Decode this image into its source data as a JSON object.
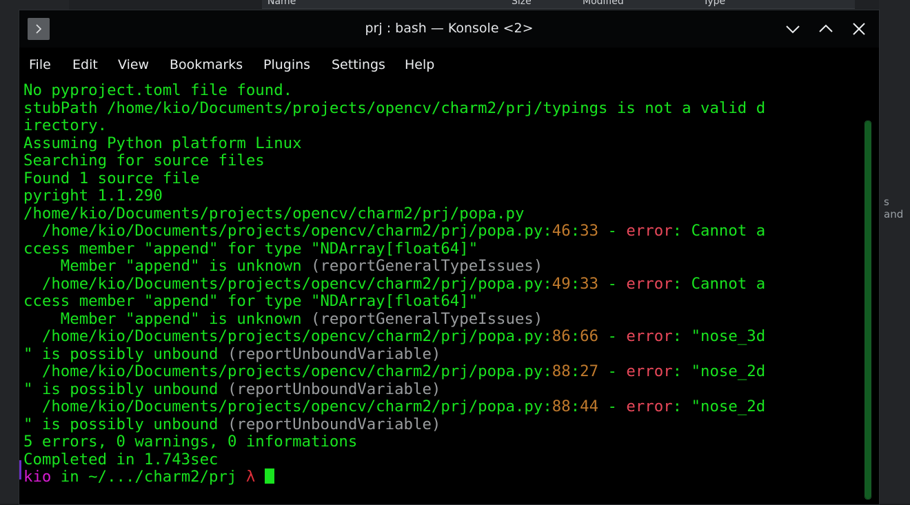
{
  "background": {
    "columns": [
      "Name",
      "Size",
      "Modified",
      "Type"
    ],
    "right_text": "s and"
  },
  "window": {
    "title": "prj : bash — Konsole <2>",
    "app_icon": "chevron-right-icon",
    "controls": [
      "minimize-icon",
      "maximize-icon",
      "close-icon"
    ]
  },
  "menu": {
    "items": [
      "File",
      "Edit",
      "View",
      "Bookmarks",
      "Plugins",
      "Settings",
      "Help"
    ]
  },
  "terminal": {
    "lines": [
      {
        "segments": [
          {
            "t": "No pyproject.toml file found.",
            "c": "g"
          }
        ]
      },
      {
        "segments": [
          {
            "t": "stubPath /home/kio/Documents/projects/opencv/charm2/prj/typings is not a valid d",
            "c": "g"
          }
        ]
      },
      {
        "segments": [
          {
            "t": "irectory.",
            "c": "g"
          }
        ]
      },
      {
        "segments": [
          {
            "t": "Assuming Python platform Linux",
            "c": "g"
          }
        ]
      },
      {
        "segments": [
          {
            "t": "Searching for source files",
            "c": "g"
          }
        ]
      },
      {
        "segments": [
          {
            "t": "Found 1 source file",
            "c": "g"
          }
        ]
      },
      {
        "segments": [
          {
            "t": "pyright 1.1.290",
            "c": "g"
          }
        ]
      },
      {
        "segments": [
          {
            "t": "/home/kio/Documents/projects/opencv/charm2/prj/popa.py",
            "c": "g"
          }
        ]
      },
      {
        "segments": [
          {
            "t": "  /home/kio/Documents/projects/opencv/charm2/prj/popa.py:",
            "c": "g"
          },
          {
            "t": "46",
            "c": "n"
          },
          {
            "t": ":",
            "c": "g"
          },
          {
            "t": "33",
            "c": "n"
          },
          {
            "t": " - ",
            "c": "g"
          },
          {
            "t": "error",
            "c": "e"
          },
          {
            "t": ": Cannot a",
            "c": "g"
          }
        ]
      },
      {
        "segments": [
          {
            "t": "ccess member \"append\" for type \"NDArray[float64]\"",
            "c": "g"
          }
        ]
      },
      {
        "segments": [
          {
            "t": "    Member \"append\" is unknown ",
            "c": "g"
          },
          {
            "t": "(reportGeneralTypeIssues)",
            "c": "d"
          }
        ]
      },
      {
        "segments": [
          {
            "t": "  /home/kio/Documents/projects/opencv/charm2/prj/popa.py:",
            "c": "g"
          },
          {
            "t": "49",
            "c": "n"
          },
          {
            "t": ":",
            "c": "g"
          },
          {
            "t": "33",
            "c": "n"
          },
          {
            "t": " - ",
            "c": "g"
          },
          {
            "t": "error",
            "c": "e"
          },
          {
            "t": ": Cannot a",
            "c": "g"
          }
        ]
      },
      {
        "segments": [
          {
            "t": "ccess member \"append\" for type \"NDArray[float64]\"",
            "c": "g"
          }
        ]
      },
      {
        "segments": [
          {
            "t": "    Member \"append\" is unknown ",
            "c": "g"
          },
          {
            "t": "(reportGeneralTypeIssues)",
            "c": "d"
          }
        ]
      },
      {
        "segments": [
          {
            "t": "  /home/kio/Documents/projects/opencv/charm2/prj/popa.py:",
            "c": "g"
          },
          {
            "t": "86",
            "c": "n"
          },
          {
            "t": ":",
            "c": "g"
          },
          {
            "t": "66",
            "c": "n"
          },
          {
            "t": " - ",
            "c": "g"
          },
          {
            "t": "error",
            "c": "e"
          },
          {
            "t": ": \"nose_3d",
            "c": "g"
          }
        ]
      },
      {
        "segments": [
          {
            "t": "\" is possibly unbound ",
            "c": "g"
          },
          {
            "t": "(reportUnboundVariable)",
            "c": "d"
          }
        ]
      },
      {
        "segments": [
          {
            "t": "  /home/kio/Documents/projects/opencv/charm2/prj/popa.py:",
            "c": "g"
          },
          {
            "t": "88",
            "c": "n"
          },
          {
            "t": ":",
            "c": "g"
          },
          {
            "t": "27",
            "c": "n"
          },
          {
            "t": " - ",
            "c": "g"
          },
          {
            "t": "error",
            "c": "e"
          },
          {
            "t": ": \"nose_2d",
            "c": "g"
          }
        ]
      },
      {
        "segments": [
          {
            "t": "\" is possibly unbound ",
            "c": "g"
          },
          {
            "t": "(reportUnboundVariable)",
            "c": "d"
          }
        ]
      },
      {
        "segments": [
          {
            "t": "  /home/kio/Documents/projects/opencv/charm2/prj/popa.py:",
            "c": "g"
          },
          {
            "t": "88",
            "c": "n"
          },
          {
            "t": ":",
            "c": "g"
          },
          {
            "t": "44",
            "c": "n"
          },
          {
            "t": " - ",
            "c": "g"
          },
          {
            "t": "error",
            "c": "e"
          },
          {
            "t": ": \"nose_2d",
            "c": "g"
          }
        ]
      },
      {
        "segments": [
          {
            "t": "\" is possibly unbound ",
            "c": "g"
          },
          {
            "t": "(reportUnboundVariable)",
            "c": "d"
          }
        ]
      },
      {
        "segments": [
          {
            "t": "5 errors, 0 warnings, 0 informations",
            "c": "g"
          }
        ]
      },
      {
        "segments": [
          {
            "t": "Completed in 1.743sec",
            "c": "g"
          }
        ]
      }
    ],
    "prompt": {
      "user": "kio",
      "sep": " in ",
      "path": "~/.../charm2/prj",
      "symbol": "λ"
    }
  },
  "colors": {
    "text": "#19e31f",
    "number": "#c07a2d",
    "error": "#e8485a",
    "dim": "#9a9d9f",
    "user": "#d81bd2",
    "lambda": "#e02f3a"
  }
}
